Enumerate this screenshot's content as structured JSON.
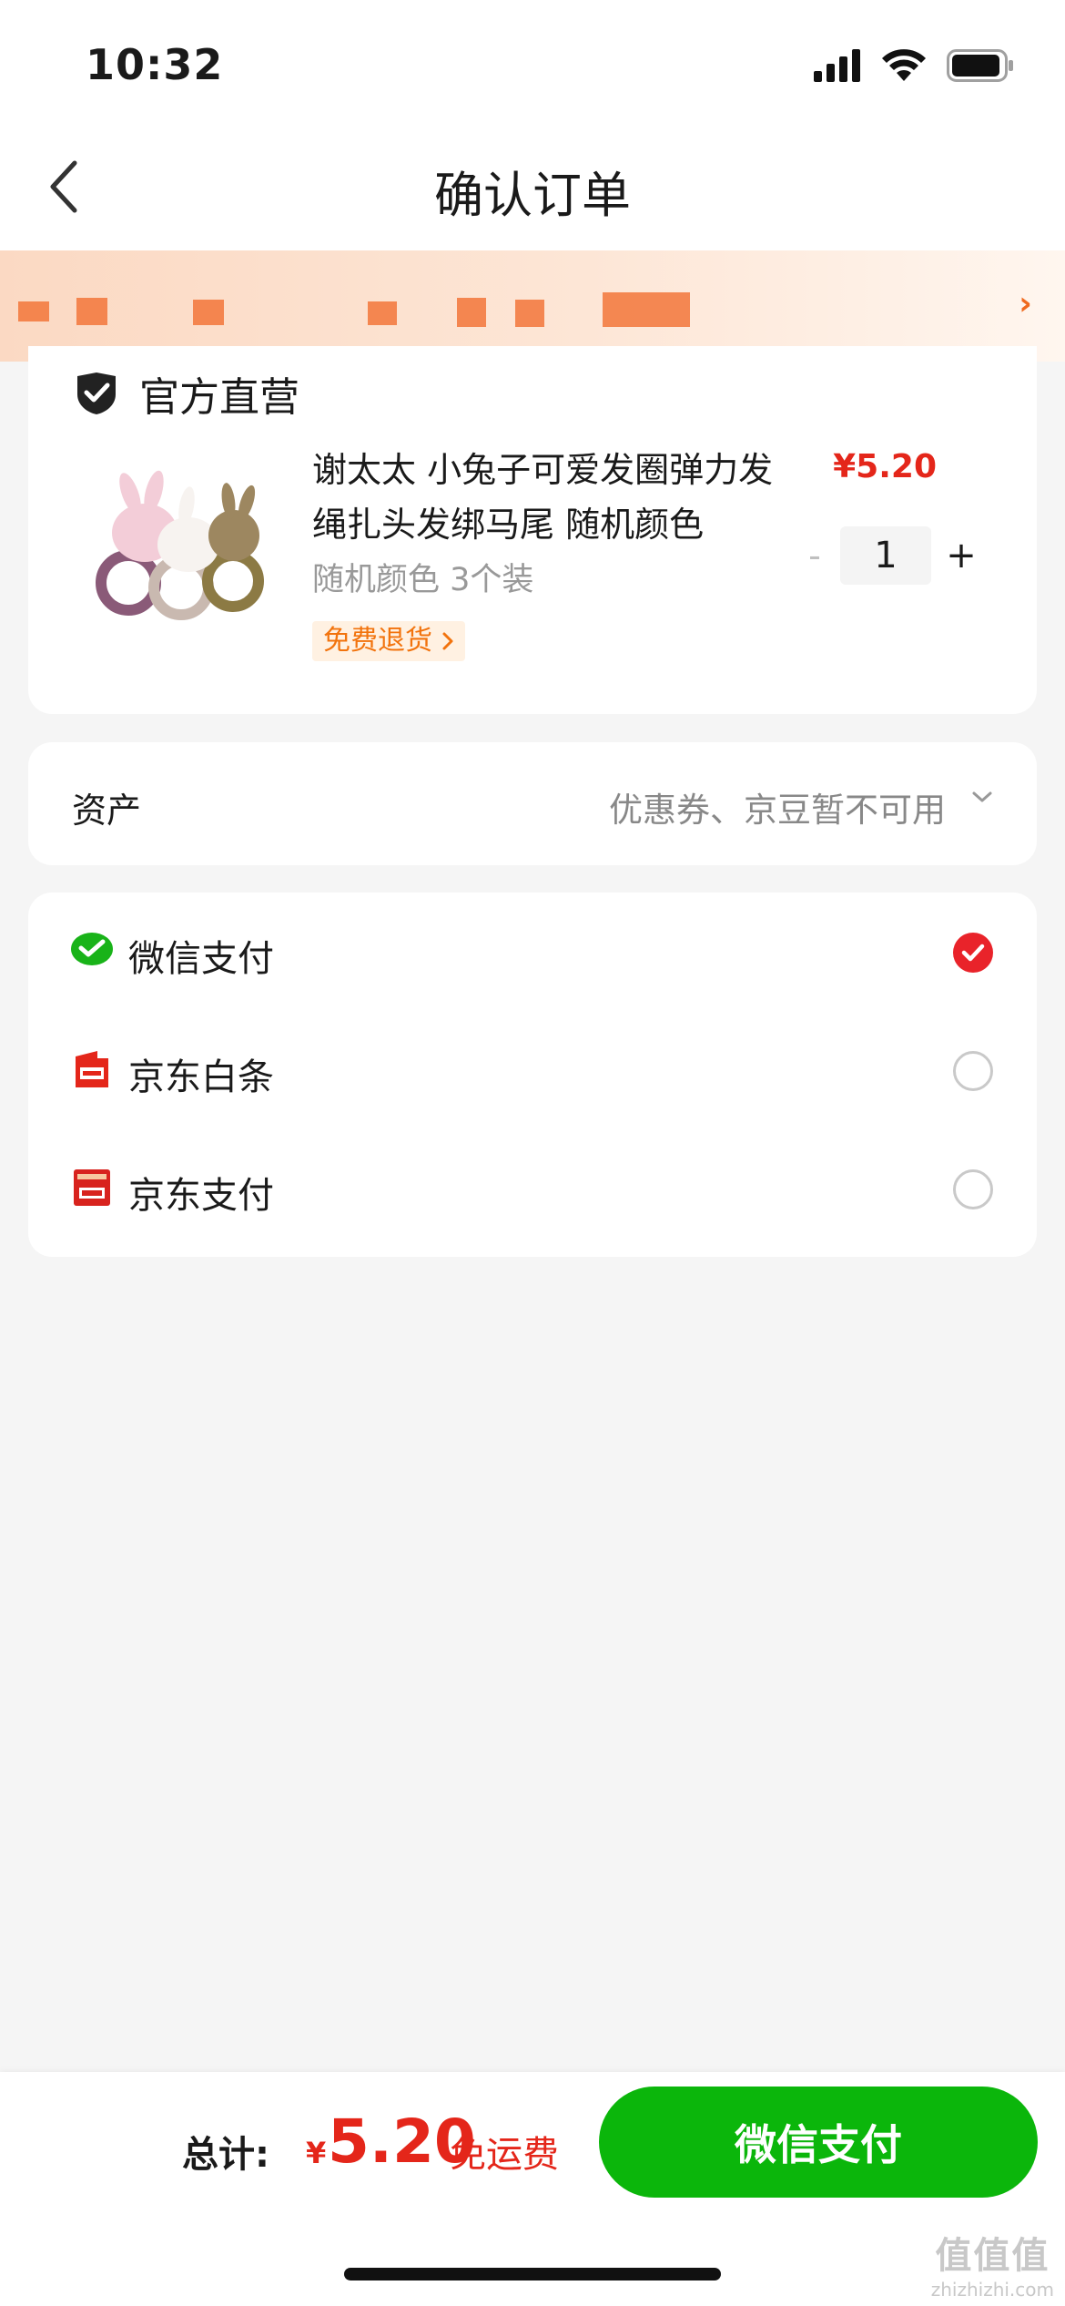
{
  "status_bar": {
    "time": "10:32"
  },
  "nav": {
    "title": "确认订单"
  },
  "store": {
    "name": "官方直营"
  },
  "product": {
    "title": "谢太太 小兔子可爱发圈弹力发绳扎头发绑马尾 随机颜色",
    "spec": "随机颜色 3个装",
    "return_tag": "免费退货",
    "price": "¥5.20",
    "quantity": "1",
    "minus": "-",
    "plus": "+"
  },
  "assets": {
    "label": "资产",
    "value": "优惠券、京豆暂不可用"
  },
  "payment_methods": [
    {
      "label": "微信支付",
      "icon": "wechat-pay-icon",
      "selected": true
    },
    {
      "label": "京东白条",
      "icon": "jd-baitiao-icon",
      "selected": false
    },
    {
      "label": "京东支付",
      "icon": "jd-pay-icon",
      "selected": false
    }
  ],
  "footer": {
    "total_label": "总计:",
    "currency": "¥",
    "total": "5.20",
    "shipping": "免运费",
    "pay_button": "微信支付"
  },
  "watermark": {
    "logo": "值值值",
    "url": "zhizhizhi.com"
  },
  "colors": {
    "price_red": "#e4261a",
    "wechat_green": "#0bb60b",
    "accent_orange": "#f2730d",
    "radio_red": "#e9232a"
  }
}
